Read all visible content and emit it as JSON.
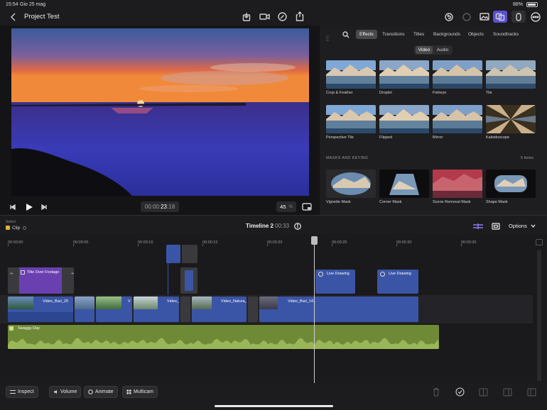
{
  "status_bar": {
    "time": "15:54",
    "date": "Gio 25 mag",
    "battery": "88%"
  },
  "top_bar": {
    "project_title": "Project Test"
  },
  "viewer": {
    "timecode_prefix": "00:00:",
    "timecode_main": "23",
    "timecode_frames": ":18",
    "zoom_value": "45",
    "zoom_unit": "%"
  },
  "browser": {
    "tabs": [
      {
        "label": "Effects",
        "active": true
      },
      {
        "label": "Transitions",
        "active": false
      },
      {
        "label": "Titles",
        "active": false
      },
      {
        "label": "Backgrounds",
        "active": false
      },
      {
        "label": "Objects",
        "active": false
      },
      {
        "label": "Soundtracks",
        "active": false
      }
    ],
    "segments": [
      {
        "label": "Video",
        "active": true
      },
      {
        "label": "Audio",
        "active": false
      }
    ],
    "effects": [
      {
        "label": "Crop & Feather"
      },
      {
        "label": "Droplet"
      },
      {
        "label": "Fisheye"
      },
      {
        "label": "Tile"
      },
      {
        "label": "Perspective Tile"
      },
      {
        "label": "Flipped"
      },
      {
        "label": "Mirror"
      },
      {
        "label": "Kaleidoscope"
      }
    ],
    "masks_section": {
      "title": "MASKS AND KEYING",
      "count": "5 Items"
    },
    "masks": [
      {
        "label": "Vignette Mask"
      },
      {
        "label": "Corner Mask"
      },
      {
        "label": "Scene Removal Mask"
      },
      {
        "label": "Shape Mask"
      }
    ]
  },
  "timeline_header": {
    "select_label": "Select",
    "select_value": "Clip",
    "timeline_name": "Timeline 2",
    "duration": "00:33",
    "options_label": "Options"
  },
  "ruler": {
    "ticks": [
      "00:00:00",
      "00:00:05",
      "00:00:10",
      "00:00:15",
      "00:00:20",
      "00:00:25",
      "00:00:30",
      "00:00:35"
    ]
  },
  "clips": {
    "title_clip": "Title Over Footage",
    "live_drawing_1": "Live Drawing",
    "live_drawing_2": "Live Drawing",
    "video_1": "Video_Bari_29",
    "video_2": "V",
    "video_3": "Video_",
    "video_4": "Video_Natura_",
    "video_5": "Video_Bari_141",
    "audio": "Swaggy Day"
  },
  "bottom_toolbar": {
    "inspect": "Inspect",
    "volume": "Volume",
    "animate": "Animate",
    "multicam": "Multicam"
  },
  "colors": {
    "accent": "#5a4fd6",
    "video_clip": "#3b55a6",
    "title_clip": "#6a40b0",
    "audio_clip": "#6f8a36",
    "playhead": "#d0d0d0"
  }
}
